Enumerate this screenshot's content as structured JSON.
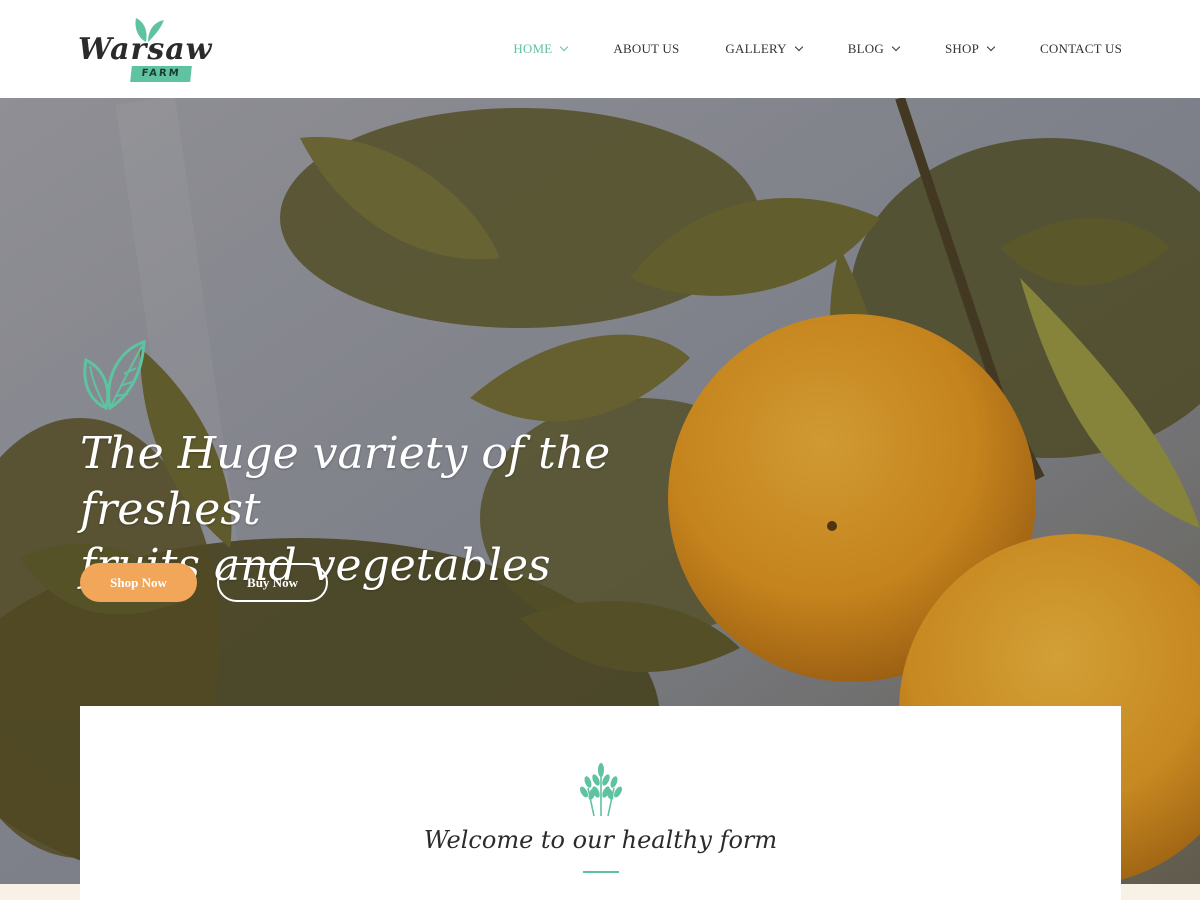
{
  "brand": {
    "name": "Warsaw",
    "tag": "FARM",
    "accent": "#5fc2a0"
  },
  "nav": {
    "items": [
      {
        "label": "HOME",
        "active": true,
        "dropdown": true
      },
      {
        "label": "ABOUT US",
        "active": false,
        "dropdown": false
      },
      {
        "label": "GALLERY",
        "active": false,
        "dropdown": true
      },
      {
        "label": "BLOG",
        "active": false,
        "dropdown": true
      },
      {
        "label": "SHOP",
        "active": false,
        "dropdown": true
      },
      {
        "label": "CONTACT US",
        "active": false,
        "dropdown": false
      }
    ]
  },
  "hero": {
    "title_line1": "The Huge variety of the freshest",
    "title_line2": "fruits and vegetables",
    "shop_button": "Shop Now",
    "buy_button": "Buy Now",
    "shop_button_color": "#f2a65a"
  },
  "welcome": {
    "title": "Welcome to our healthy form"
  }
}
